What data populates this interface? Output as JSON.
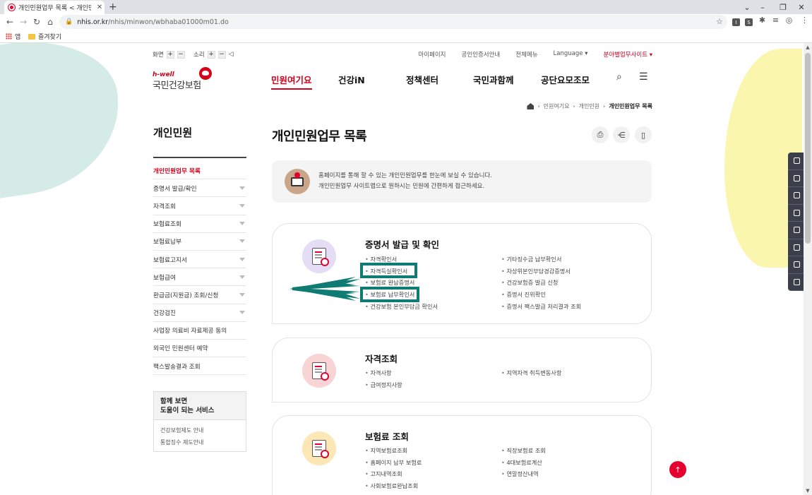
{
  "browser": {
    "tab_title": "개인민원업무 목록 < 개인민원",
    "url_host": "nhis.or.kr",
    "url_path": "/nhis/minwon/wbhaba01000m01.do",
    "bookmarks": [
      {
        "label": "앱"
      },
      {
        "label": "즐겨찾기"
      }
    ],
    "extensions": [
      "I",
      "S"
    ]
  },
  "utility": {
    "screen_label": "화면",
    "sound_label": "소리",
    "links": [
      "마이페이지",
      "공인인증서안내",
      "전체메뉴",
      "Language ▾",
      "분야별업무사이트 ▾"
    ]
  },
  "logo": {
    "hwell": "h-well",
    "name": "국민건강보험"
  },
  "gnb": [
    "민원여기요",
    "건강iN",
    "정책센터",
    "국민과함께",
    "공단요모조모"
  ],
  "breadcrumb": [
    "민원여기요",
    "개인민원",
    "개인민원업무 목록"
  ],
  "sidebar": {
    "title": "개인민원",
    "items": [
      {
        "label": "개인민원업무 목록",
        "arrow": false
      },
      {
        "label": "증명서 발급/확인",
        "arrow": true
      },
      {
        "label": "자격조회",
        "arrow": true
      },
      {
        "label": "보험료조회",
        "arrow": true
      },
      {
        "label": "보험료납부",
        "arrow": true
      },
      {
        "label": "보험료고지서",
        "arrow": true
      },
      {
        "label": "보험급여",
        "arrow": true
      },
      {
        "label": "환급금(지원금) 조회/신청",
        "arrow": true
      },
      {
        "label": "건강검진",
        "arrow": true
      },
      {
        "label": "사업장 의료비 자료제공 동의",
        "arrow": false
      },
      {
        "label": "외국인 민원센터 예약",
        "arrow": false
      },
      {
        "label": "팩스발송결과 조회",
        "arrow": false
      }
    ],
    "related_title_1": "함께 보면",
    "related_title_2": "도움이 되는 서비스",
    "related_links": [
      "건강보험제도 안내",
      "통합징수 제도안내"
    ]
  },
  "main": {
    "title": "개인민원업무 목록",
    "notice_line1": "홈페이지를 통해 할 수 있는 개인민원업무를 한눈에 보실 수 있습니다.",
    "notice_line2": "개인민원업무 사이트맵으로 원하시는 민원에 간편하게 접근하세요."
  },
  "cards": [
    {
      "title": "증명서 발급 및 확인",
      "icon": "certificate-icon",
      "color": "#e5dcf5",
      "left": [
        "자격확인서",
        "자격득실확인서",
        "보험료 완납증명서",
        "보험료 납부확인서",
        "건강보험 본인부담금 확인서"
      ],
      "right": [
        "기타징수금 납부확인서",
        "차상위본인부담경감증명서",
        "건강보험증 발급 신청",
        "증명서 진위확인",
        "증명서 팩스발급 처리결과 조회"
      ]
    },
    {
      "title": "자격조회",
      "icon": "id-card-icon",
      "color": "#f9d4d4",
      "left": [
        "자격사항",
        "급여정지사항"
      ],
      "right": [
        "지역자격 취득변동사항"
      ]
    },
    {
      "title": "보험료 조회",
      "icon": "premium-search-icon",
      "color": "#fce7b5",
      "left": [
        "지역보험료조회",
        "홈페이지 납부 보험료",
        "고지내역조회",
        "사회보험료완납조회"
      ],
      "right": [
        "직장보험료 조회",
        "4대보험료계산",
        "연말정산내역"
      ]
    }
  ],
  "colors": {
    "brand": "#d5001c",
    "highlight": "#0e7c73"
  }
}
